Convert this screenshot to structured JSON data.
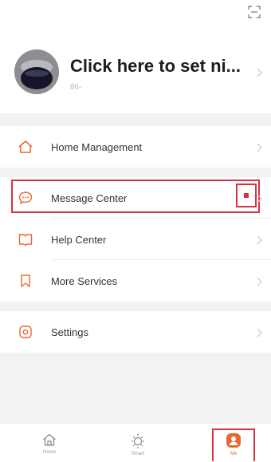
{
  "profile": {
    "nickname": "Click here to set ni...",
    "account": "86-"
  },
  "menu_groups": [
    {
      "items": [
        {
          "label": "Home Management",
          "icon": "house-icon"
        }
      ]
    },
    {
      "items": [
        {
          "label": "Message Center",
          "icon": "chat-bubble-icon",
          "badge": "red-dot"
        },
        {
          "label": "Help Center",
          "icon": "book-icon"
        },
        {
          "label": "More Services",
          "icon": "bookmark-icon"
        }
      ]
    },
    {
      "items": [
        {
          "label": "Settings",
          "icon": "gear-icon"
        }
      ]
    }
  ],
  "tabbar": {
    "tabs": [
      {
        "label": "Home",
        "icon": "house-icon",
        "active": false
      },
      {
        "label": "Smart",
        "icon": "sun-icon",
        "active": false
      },
      {
        "label": "Me",
        "icon": "person-icon",
        "active": true
      }
    ]
  },
  "colors": {
    "accent": "#e8672f",
    "highlight": "#d63340",
    "background": "#f2f2f4"
  }
}
